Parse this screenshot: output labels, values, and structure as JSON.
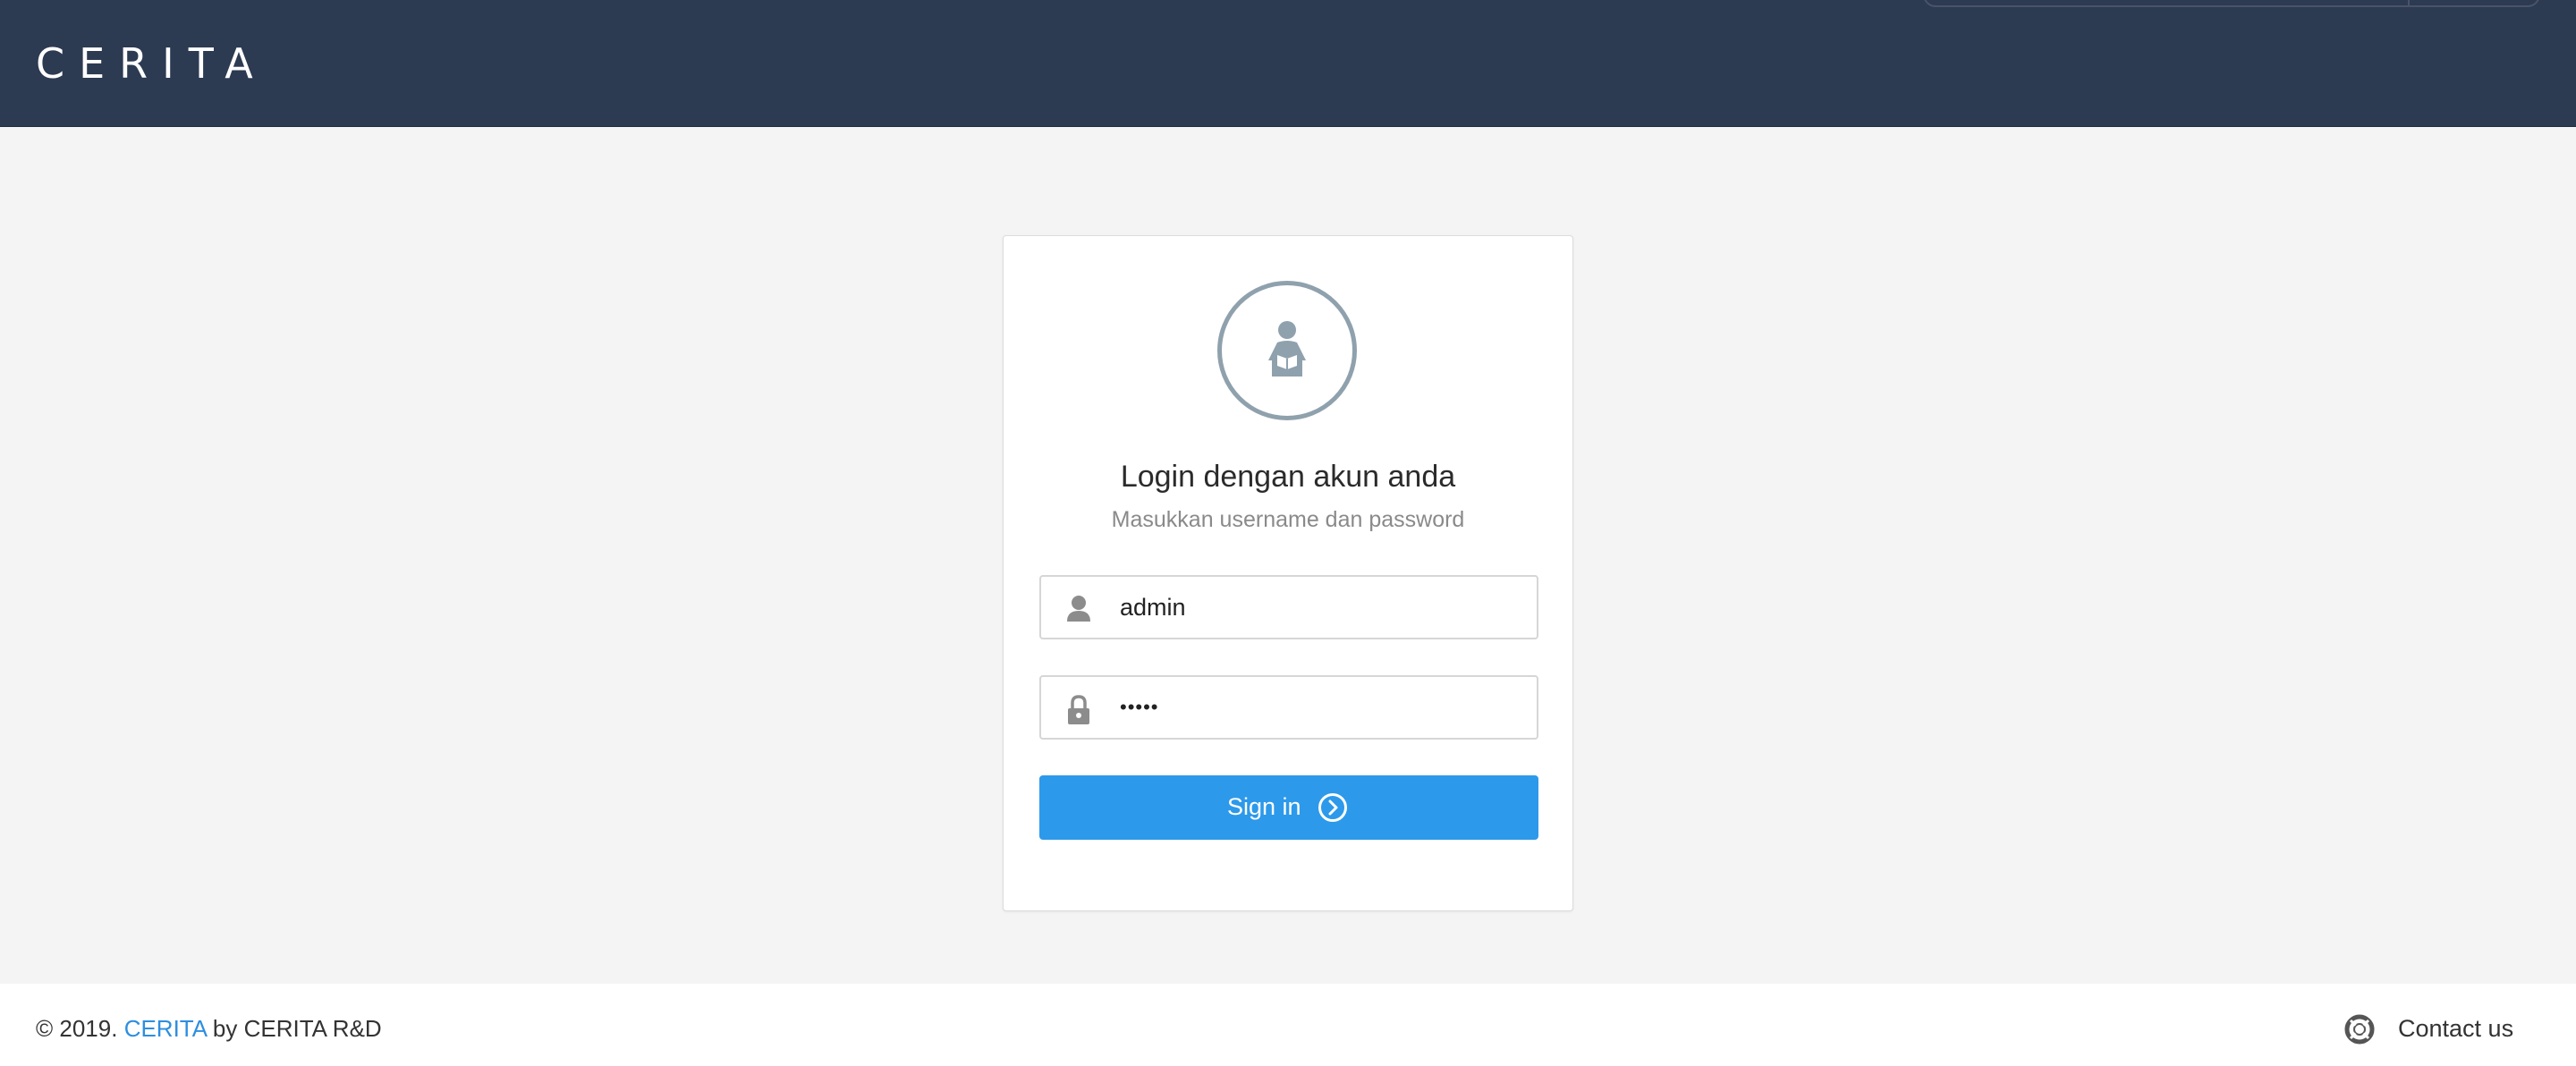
{
  "header": {
    "brand": "CERITA"
  },
  "login": {
    "title": "Login dengan akun anda",
    "subtitle": "Masukkan username dan password",
    "username_value": "admin",
    "password_value": "•••••",
    "signin_label": "Sign in"
  },
  "footer": {
    "copyright_prefix": "© 2019.",
    "copyright_link": "CERITA",
    "copyright_suffix": "by CERITA R&D",
    "contact_label": "Contact us"
  },
  "icons": {
    "avatar": "reader-icon",
    "username": "user-icon",
    "password": "lock-icon",
    "signin": "arrow-circle-right-icon",
    "contact": "lifebuoy-icon"
  },
  "colors": {
    "header_bg": "#2c3a52",
    "page_bg": "#f4f4f4",
    "accent": "#2d99ea",
    "link": "#2d8ee0",
    "avatar_ring": "#8fa1ad"
  }
}
